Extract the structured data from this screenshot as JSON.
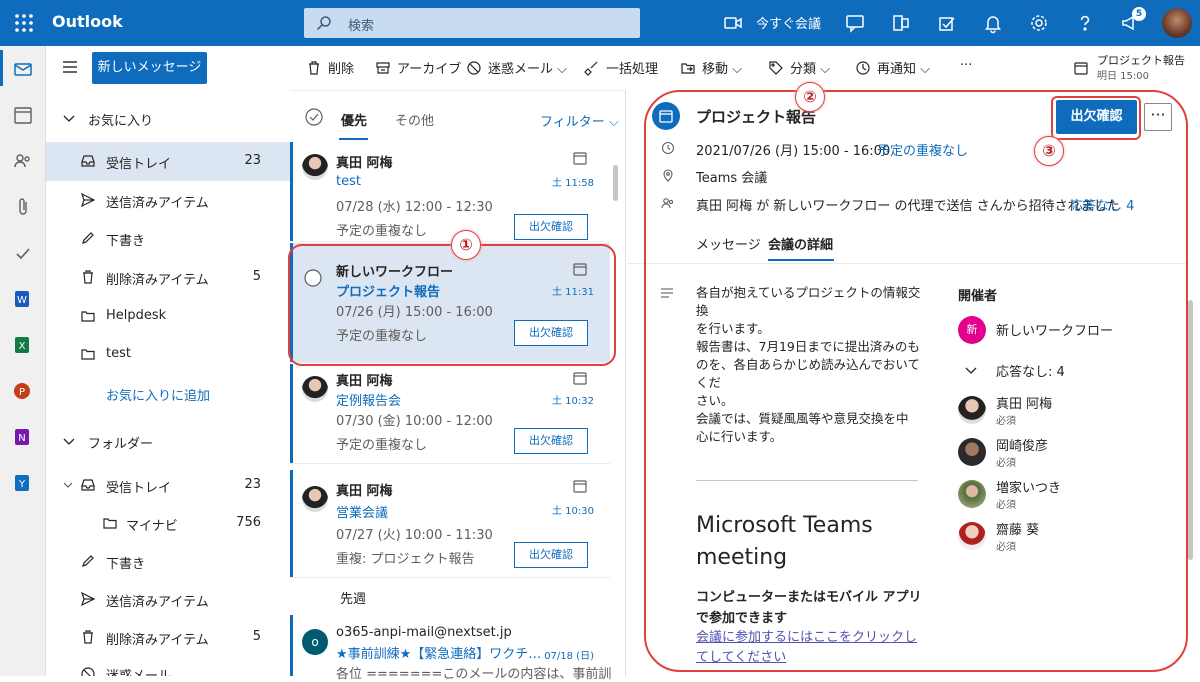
{
  "app": {
    "name": "Outlook"
  },
  "search": {
    "placeholder": "検索"
  },
  "topbar": {
    "meet_now": "今すぐ会議",
    "notification_count": "5"
  },
  "toolbar": {
    "delete": "削除",
    "archive": "アーカイブ",
    "junk": "迷惑メール",
    "sweep": "一括処理",
    "move": "移動",
    "categorize": "分類",
    "snooze": "再通知",
    "more": "···",
    "reminder_title": "プロジェクト報告",
    "reminder_time": "明日 15:00"
  },
  "nav": {
    "new_message": "新しいメッセージ",
    "favorites": "お気に入り",
    "fav_items": [
      {
        "label": "受信トレイ",
        "count": "23"
      },
      {
        "label": "送信済みアイテム",
        "count": ""
      },
      {
        "label": "下書き",
        "count": ""
      },
      {
        "label": "削除済みアイテム",
        "count": "5"
      },
      {
        "label": "Helpdesk",
        "count": ""
      },
      {
        "label": "test",
        "count": ""
      }
    ],
    "add_favorite": "お気に入りに追加",
    "folders": "フォルダー",
    "folder_items": [
      {
        "label": "受信トレイ",
        "count": "23"
      },
      {
        "label": "マイナビ",
        "count": "756"
      },
      {
        "label": "下書き",
        "count": ""
      },
      {
        "label": "送信済みアイテム",
        "count": ""
      },
      {
        "label": "削除済みアイテム",
        "count": "5"
      },
      {
        "label": "迷惑メール",
        "count": ""
      }
    ]
  },
  "list": {
    "tab_focused": "優先",
    "tab_other": "その他",
    "filter": "フィルター",
    "section_last_week": "先週",
    "items": [
      {
        "from": "真田 阿梅",
        "subject": "test",
        "time": "07/28 (水) 12:00 - 12:30",
        "note": "予定の重複なし",
        "received": "土 11:58",
        "rsvp": "出欠確認"
      },
      {
        "from": "新しいワークフロー",
        "subject": "プロジェクト報告",
        "time": "07/26 (月) 15:00 - 16:00",
        "note": "予定の重複なし",
        "received": "土 11:31",
        "rsvp": "出欠確認"
      },
      {
        "from": "真田 阿梅",
        "subject": "定例報告会",
        "time": "07/30 (金) 10:00 - 12:00",
        "note": "予定の重複なし",
        "received": "土 10:32",
        "rsvp": "出欠確認"
      },
      {
        "from": "真田 阿梅",
        "subject": "営業会議",
        "time": "07/27 (火) 10:00 - 11:30",
        "note": "重複: プロジェクト報告",
        "received": "土 10:30",
        "rsvp": "出欠確認"
      }
    ],
    "last_item": {
      "avatar_initial": "o",
      "from": "o365-anpi-mail@nextset.jp",
      "subject": "★事前訓練★【緊急連絡】ワクチ…",
      "received": "07/18 (日)",
      "preview": "各位 =======このメールの内容は、事前訓"
    }
  },
  "reading": {
    "title": "プロジェクト報告",
    "rsvp": "出欠確認",
    "more": "···",
    "datetime": "2021/07/26 (月) 15:00 - 16:00",
    "no_conflict": "予定の重複なし",
    "location": "Teams 会議",
    "invite": "真田 阿梅 が 新しいワークフロー の代理で送信 さんから招待されました",
    "no_response": "応答なし 4",
    "tab_message": "メッセージ",
    "tab_details": "会議の詳細",
    "body_lines": [
      "各自が抱えているプロジェクトの情報交換",
      "を行います。",
      "報告書は、7月19日までに提出済みのも",
      "のを、各自あらかじめ読み込んでおいてくだ",
      "さい。",
      "会議では、質疑風風等や意見交換を中",
      "心に行います。"
    ],
    "teams_title": "Microsoft Teams meeting",
    "teams_cta": "コンピューターまたはモバイル アプリで参加できます",
    "teams_link": "会議に参加するにはここをクリックしてしてください",
    "organizer_label": "開催者",
    "organizer_initial": "新",
    "organizer_name": "新しいワークフロー",
    "no_response_label": "応答なし: 4",
    "attendees": [
      {
        "name": "真田 阿梅",
        "role": "必須"
      },
      {
        "name": "岡崎俊彦",
        "role": "必須"
      },
      {
        "name": "増家いつき",
        "role": "必須"
      },
      {
        "name": "齋藤 葵",
        "role": "必須"
      }
    ]
  },
  "annotations": [
    "①",
    "②",
    "③"
  ],
  "colors": {
    "brand": "#0f6cbd",
    "selected_bg": "#dce6f2",
    "annotation": "#e04040"
  }
}
